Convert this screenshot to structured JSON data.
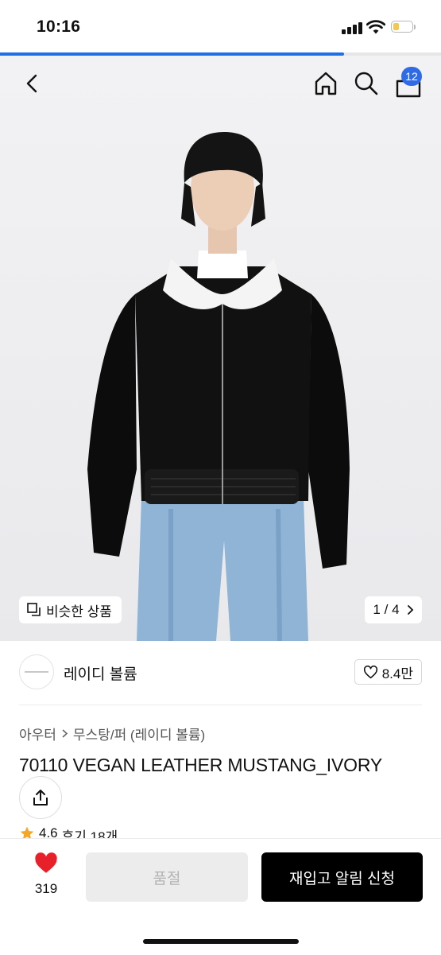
{
  "status_bar": {
    "time": "10:16",
    "battery_level": 0.2
  },
  "page_progress": 0.78,
  "nav": {
    "cart_count": "12",
    "icons": [
      "back-icon",
      "home-icon",
      "search-icon",
      "cart-icon"
    ]
  },
  "gallery": {
    "similar_label": "비슷한 상품",
    "page_current": "1",
    "page_separator": "/",
    "page_total": "4"
  },
  "brand": {
    "name": "레이디 볼륨",
    "likes": "8.4만"
  },
  "breadcrumb": [
    "아우터",
    "무스탕/퍼 (레이디 볼륨)"
  ],
  "product": {
    "title": "70110 VEGAN LEATHER MUSTANG_IVORY",
    "rating": "4.6",
    "reviews": "후기 18개"
  },
  "bottom_bar": {
    "wish_count": "319",
    "soldout_label": "품절",
    "restock_label": "재입고 알림 신청"
  },
  "colors": {
    "accent": "#2f6be6",
    "heart": "#e8202a",
    "star": "#f5a623",
    "primary_button": "#000000",
    "disabled_button": "#ececec"
  }
}
